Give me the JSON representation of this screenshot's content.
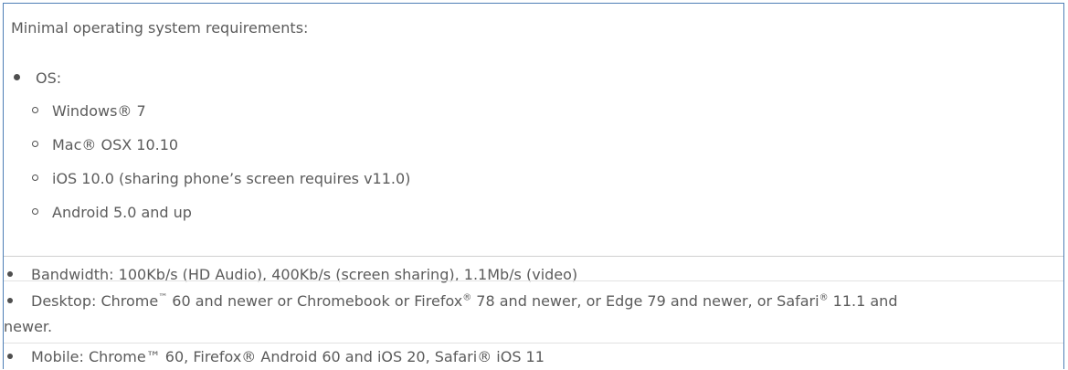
{
  "intro": "Minimal operating system requirements:",
  "os": {
    "label": "OS:",
    "items": [
      "Windows® 7",
      "Mac® OSX 10.10",
      "iOS 10.0 (sharing phone’s screen requires v11.0)",
      "Android 5.0 and up"
    ]
  },
  "bandwidth": "Bandwidth: 100Kb/s (HD Audio), 400Kb/s (screen sharing), 1.1Mb/s (video)",
  "desktop": {
    "p1": "Desktop: Chrome",
    "tm": "™",
    "p2": " 60 and newer or Chromebook or Firefox",
    "reg1": "®",
    "p3": " 78 and newer, or Edge 79 and newer, or Safari",
    "reg2": "®",
    "p4": " 11.1 and",
    "wrap": "newer."
  },
  "mobile": "Mobile: Chrome™ 60, Firefox® Android 60 and iOS 20, Safari® iOS 11"
}
